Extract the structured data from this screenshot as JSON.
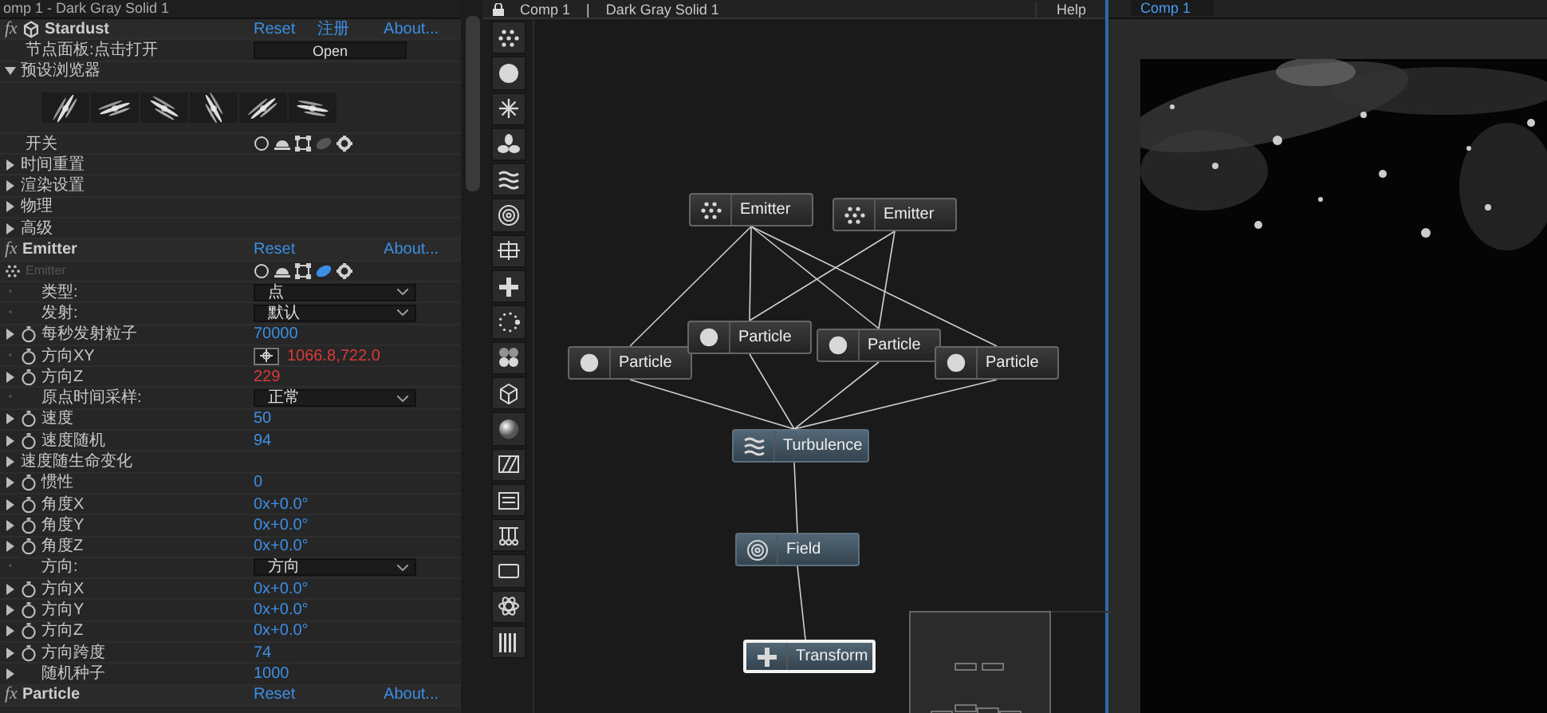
{
  "left_panel": {
    "breadcrumb": "omp 1 - Dark Gray Solid 1",
    "rows": [
      {
        "kind": "effect",
        "badge": "fx",
        "label": "Stardust",
        "links": [
          "Reset",
          "注册",
          "About..."
        ]
      },
      {
        "kind": "button",
        "label": "节点面板:点击打开",
        "button": "Open"
      },
      {
        "kind": "group",
        "label": "预设浏览器",
        "expanded": true
      },
      {
        "kind": "presets"
      },
      {
        "kind": "switches",
        "label": "开关",
        "switches": [
          {
            "on": true
          },
          {
            "on": true
          },
          {
            "on": true
          },
          {
            "on": false
          },
          {
            "on": true
          }
        ]
      },
      {
        "kind": "group",
        "label": "时间重置",
        "expanded": false
      },
      {
        "kind": "group",
        "label": "渲染设置",
        "expanded": false
      },
      {
        "kind": "group",
        "label": "物理",
        "expanded": false
      },
      {
        "kind": "group",
        "label": "高级",
        "expanded": false
      },
      {
        "kind": "effect",
        "badge": "fx",
        "label": "Emitter",
        "links": [
          "Reset",
          "About..."
        ]
      },
      {
        "kind": "shapes",
        "label": "Emitter",
        "shapes": [
          {
            "selected": false
          },
          {
            "selected": false
          },
          {
            "selected": false
          },
          {
            "selected": true
          },
          {
            "selected": false
          }
        ]
      },
      {
        "kind": "dropdown",
        "label": "类型:",
        "value": "点",
        "expander": false,
        "stopwatch": false
      },
      {
        "kind": "dropdown",
        "label": "发射:",
        "value": "默认",
        "expander": false,
        "stopwatch": false
      },
      {
        "kind": "value",
        "label": "每秒发射粒子",
        "value": "70000",
        "color": "#3d8fe6",
        "expander": true,
        "stopwatch": true
      },
      {
        "kind": "point",
        "label": "方向XY",
        "value": "1066.8,722.0",
        "color": "#d83a3a",
        "expander": false,
        "stopwatch": true
      },
      {
        "kind": "value",
        "label": "方向Z",
        "value": "229",
        "color": "#d83a3a",
        "expander": true,
        "stopwatch": true
      },
      {
        "kind": "dropdown",
        "label": "原点时间采样:",
        "value": "正常",
        "expander": false,
        "stopwatch": false
      },
      {
        "kind": "value",
        "label": "速度",
        "value": "50",
        "color": "#3d8fe6",
        "expander": true,
        "stopwatch": true
      },
      {
        "kind": "value",
        "label": "速度随机",
        "value": "94",
        "color": "#3d8fe6",
        "expander": true,
        "stopwatch": true
      },
      {
        "kind": "group",
        "label": "速度随生命变化",
        "expanded": false
      },
      {
        "kind": "value",
        "label": "惯性",
        "value": "0",
        "color": "#3d8fe6",
        "expander": true,
        "stopwatch": true
      },
      {
        "kind": "value",
        "label": "角度X",
        "value": "0x+0.0°",
        "color": "#3d8fe6",
        "expander": true,
        "stopwatch": true
      },
      {
        "kind": "value",
        "label": "角度Y",
        "value": "0x+0.0°",
        "color": "#3d8fe6",
        "expander": true,
        "stopwatch": true
      },
      {
        "kind": "value",
        "label": "角度Z",
        "value": "0x+0.0°",
        "color": "#3d8fe6",
        "expander": true,
        "stopwatch": true
      },
      {
        "kind": "dropdown",
        "label": "方向:",
        "value": "方向",
        "expander": false,
        "stopwatch": false
      },
      {
        "kind": "value",
        "label": "方向X",
        "value": "0x+0.0°",
        "color": "#3d8fe6",
        "expander": true,
        "stopwatch": true
      },
      {
        "kind": "value",
        "label": "方向Y",
        "value": "0x+0.0°",
        "color": "#3d8fe6",
        "expander": true,
        "stopwatch": true
      },
      {
        "kind": "value",
        "label": "方向Z",
        "value": "0x+0.0°",
        "color": "#3d8fe6",
        "expander": true,
        "stopwatch": true
      },
      {
        "kind": "value",
        "label": "方向跨度",
        "value": "74",
        "color": "#3d8fe6",
        "expander": true,
        "stopwatch": true
      },
      {
        "kind": "value",
        "label": "随机种子",
        "value": "1000",
        "color": "#3d8fe6",
        "expander": true,
        "stopwatch": false
      },
      {
        "kind": "effect",
        "badge": "fx",
        "label": "Particle",
        "links": [
          "Reset",
          "About..."
        ]
      }
    ]
  },
  "node_editor": {
    "breadcrumb": [
      "Comp 1",
      "|",
      "Dark Gray Solid 1"
    ],
    "help": "Help",
    "nodes": [
      {
        "kind": "emitter",
        "label": "Emitter",
        "selected": false
      },
      {
        "kind": "emitter",
        "label": "Emitter",
        "selected": false
      },
      {
        "kind": "particle",
        "label": "Particle",
        "selected": false
      },
      {
        "kind": "particle",
        "label": "Particle",
        "selected": false
      },
      {
        "kind": "particle",
        "label": "Particle",
        "selected": false
      },
      {
        "kind": "particle",
        "label": "Particle",
        "selected": false
      },
      {
        "kind": "turbulence",
        "label": "Turbulence",
        "selected": false
      },
      {
        "kind": "field",
        "label": "Field",
        "selected": false
      },
      {
        "kind": "transform",
        "label": "Transform",
        "selected": true
      }
    ]
  },
  "viewer": {
    "tab": "Comp 1"
  }
}
